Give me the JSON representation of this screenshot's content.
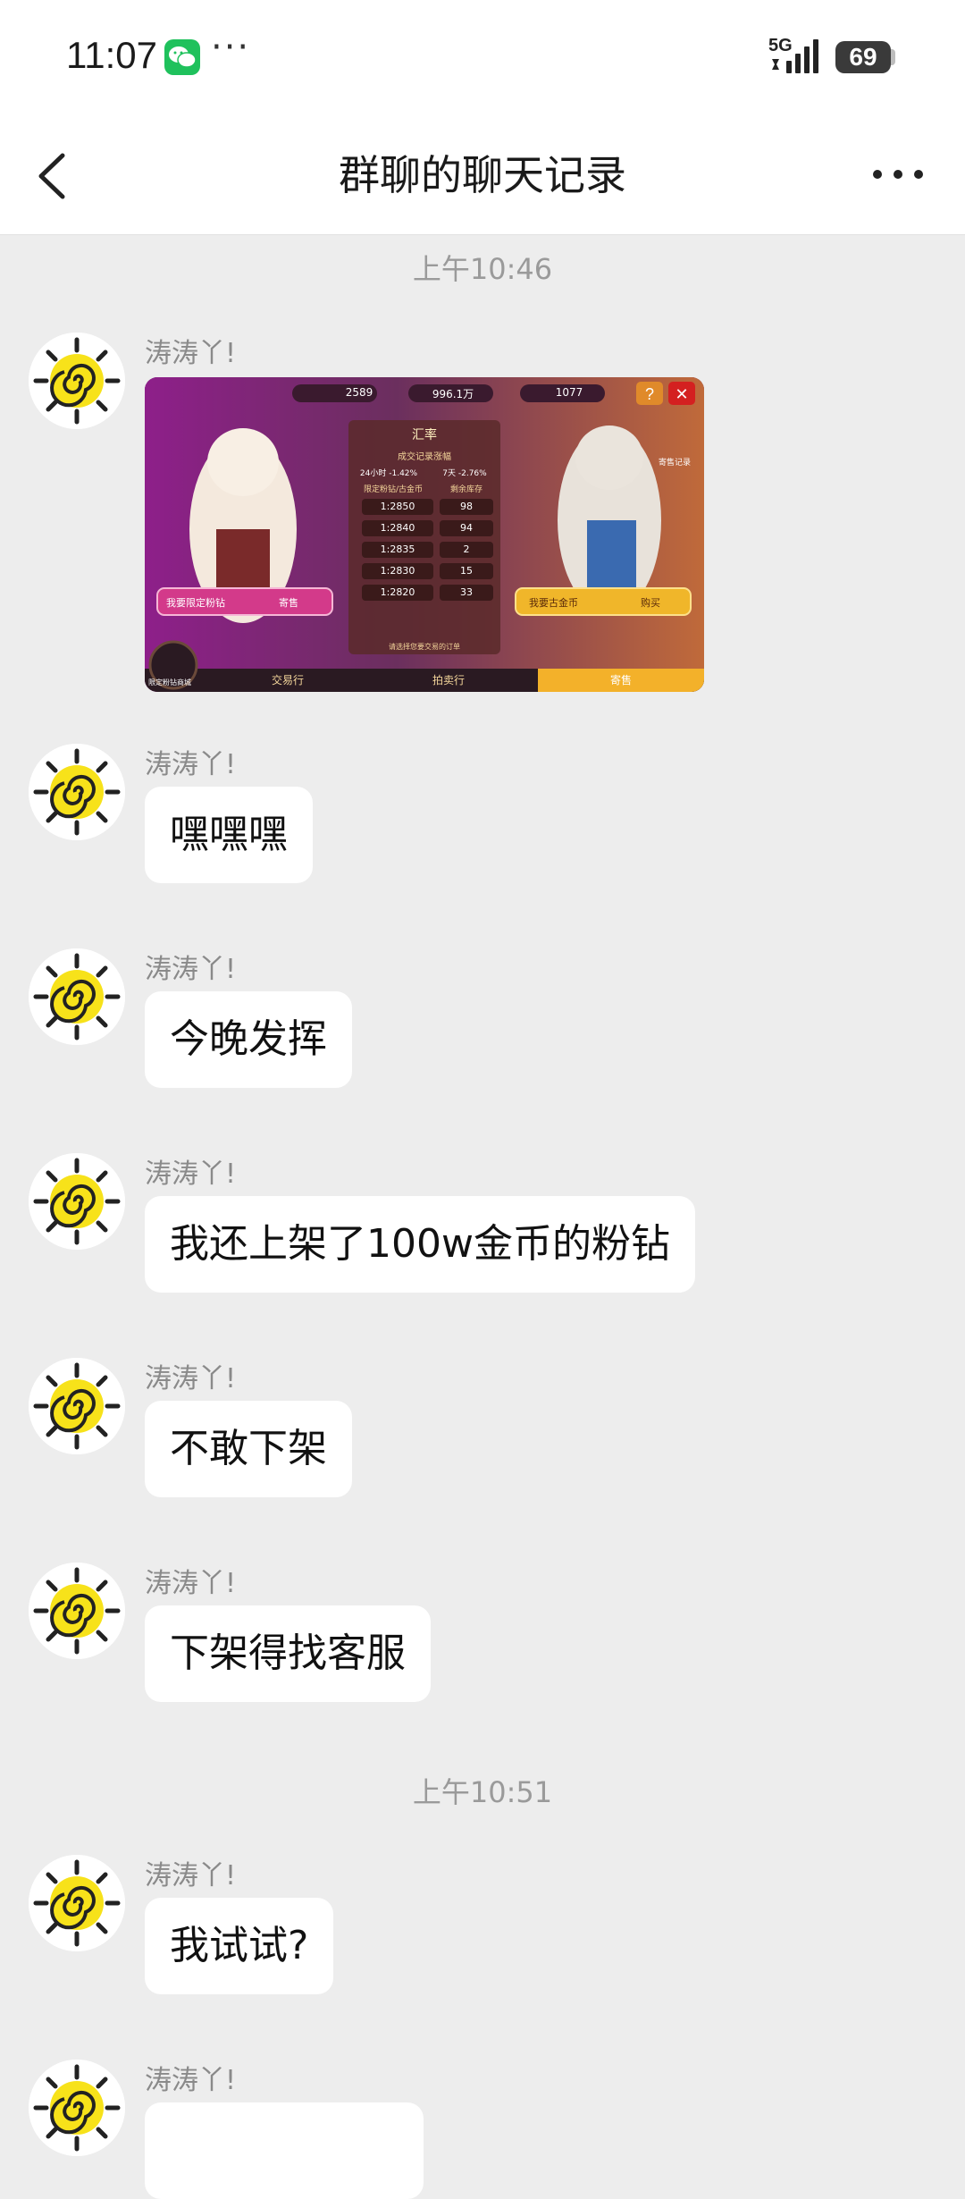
{
  "status_bar": {
    "time": "11:07",
    "more": "···",
    "network": "5G",
    "battery": "69"
  },
  "nav": {
    "title": "群聊的聊天记录"
  },
  "chat": {
    "timestamps": [
      "上午10:46",
      "上午10:51"
    ],
    "sender": "涛涛丫!",
    "messages": [
      {
        "type": "image"
      },
      {
        "type": "text",
        "text": "嘿嘿嘿"
      },
      {
        "type": "text",
        "text": "今晚发挥"
      },
      {
        "type": "text",
        "text": "我还上架了100w金币的粉钻"
      },
      {
        "type": "text",
        "text": "不敢下架"
      },
      {
        "type": "text",
        "text": "下架得找客服"
      },
      {
        "type": "text",
        "text": "我试试?"
      },
      {
        "type": "text",
        "text": ""
      }
    ]
  },
  "game_screenshot": {
    "top_values": [
      "2589",
      "996.1万",
      "1077"
    ],
    "panel_title": "汇率",
    "panel_subtitle": "成交记录涨幅",
    "change_24h": "24小时 -1.42%",
    "change_7d": "7天 -2.76%",
    "col_headers": [
      "限定粉钻/古金币",
      "剩余库存"
    ],
    "rows": [
      [
        "1:2850",
        "98"
      ],
      [
        "1:2840",
        "94"
      ],
      [
        "1:2835",
        "2"
      ],
      [
        "1:2830",
        "15"
      ],
      [
        "1:2820",
        "33"
      ]
    ],
    "left_button": "我要限定粉钻",
    "left_button_tag": "寄售",
    "right_button": "我要古金币",
    "right_button_tag": "购买",
    "record_label": "寄售记录",
    "footer_note": "请选择您要交易的订单",
    "shop_label": "限定粉钻商城",
    "tabs": [
      "交易行",
      "拍卖行",
      "寄售"
    ]
  },
  "colors": {
    "background": "#ededed",
    "bubble": "#ffffff",
    "sender": "#8a8a8a",
    "timestamp": "#9a9a9a"
  }
}
